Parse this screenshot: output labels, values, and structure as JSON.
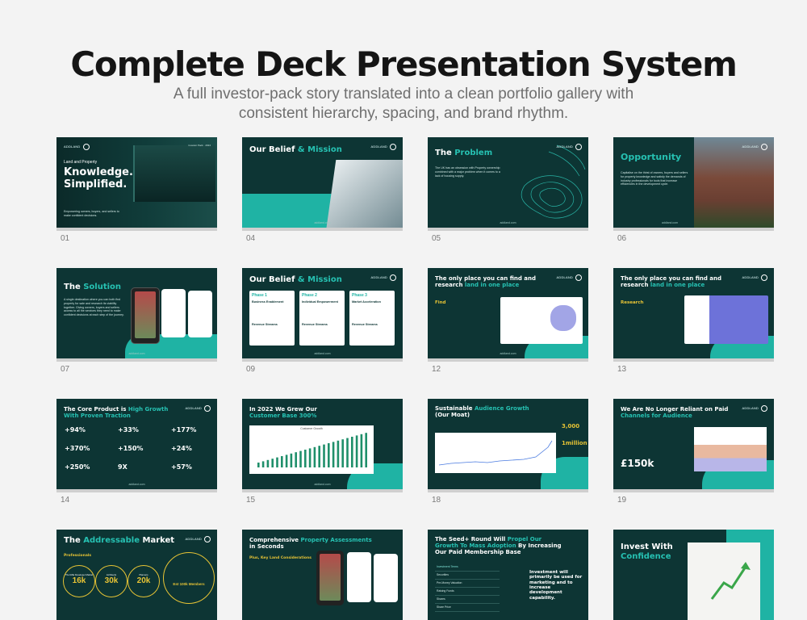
{
  "title": "Complete Deck Presentation System",
  "subtitle": "A full investor-pack story translated into a clean portfolio gallery with consistent hierarchy, spacing, and brand rhythm.",
  "brand": "ADDLAND",
  "website": "addland.com",
  "accent": "#26c1b2",
  "slides": [
    {
      "num": "01",
      "pre": "Land and Property",
      "title": "Knowledge. Simplified.",
      "body": "Empowering owners, buyers, and sellers to make confident decisions.",
      "date": "Investor Pack · 2024"
    },
    {
      "num": "04",
      "title": "Our Belief",
      "accent_text": "& Mission"
    },
    {
      "num": "05",
      "title": "The",
      "accent_text": "Problem",
      "body": "The UK has an obsession with Property ownership combined with a major problem when it comes to a lack of housing supply."
    },
    {
      "num": "06",
      "accent_text": "Opportunity",
      "body": "Capitalise on the thirst of owners, buyers and sellers for property knowledge and satisfy the demands of industry professionals for tools that increase efficiencies in the development cycle."
    },
    {
      "num": "07",
      "title": "The",
      "accent_text": "Solution",
      "body": "A single destination where you can both find property for sale and research its viability together. Giving owners, buyers and sellers access to all the services they need to make confident decisions at each step of the journey."
    },
    {
      "num": "09",
      "title": "Our Belief",
      "accent_text": "& Mission",
      "phases": [
        {
          "label": "Phase 1",
          "head": "Business Enablement"
        },
        {
          "label": "Phase 2",
          "head": "Individual Empowerment"
        },
        {
          "label": "Phase 3",
          "head": "Market Acceleration"
        }
      ],
      "subhead": "Revenue Streams"
    },
    {
      "num": "12",
      "title": "The only place you can find and research",
      "accent_text": "land in one place",
      "tag": "Find"
    },
    {
      "num": "13",
      "title": "The only place you can find and research",
      "accent_text": "land in one place",
      "tag": "Research"
    },
    {
      "num": "14",
      "title": "The Core Product is",
      "accent_text": "High Growth",
      "title2": "With Proven Traction",
      "stats": [
        "+94%",
        "+33%",
        "+177%",
        "+370%",
        "+150%",
        "+24%",
        "+250%",
        "9X",
        "+57%"
      ]
    },
    {
      "num": "15",
      "title": "In 2022 We Grew Our",
      "accent_text": "Customer Base 300%",
      "chart_title": "Customer Growth"
    },
    {
      "num": "18",
      "title": "Sustainable",
      "accent_text": "Audience Growth",
      "title2": "(Our Moat)",
      "kpis": [
        "3,000",
        "1million"
      ]
    },
    {
      "num": "19",
      "title": "We Are No Longer Reliant on Paid",
      "accent_text": "Channels for Audience",
      "kpi": "£150k"
    },
    {
      "num": "",
      "title": "The",
      "accent_text": "Addressable",
      "title2": "Market",
      "tag": "Professionals",
      "circles": [
        "16k",
        "30k",
        "20k"
      ],
      "circle_labels": [
        "The RAE Developer Market",
        "Architects",
        "Planners"
      ],
      "outer": "Est 100k Members"
    },
    {
      "num": "",
      "title": "Comprehensive",
      "accent_text": "Property Assessments",
      "title2": "in Seconds",
      "tag": "Plus, Key Land Considerations"
    },
    {
      "num": "",
      "title": "The Seed+ Round Will",
      "accent_text": "Propel Our Growth To Mass Adoption",
      "title2": "By Increasing Our Paid Membership Base",
      "body": "Investment will primarily be used for marketing and to increase development capability.",
      "rows": [
        "Investment Terms",
        "Securities",
        "Pre-Money Valuation",
        "Raising Funds",
        "Shares",
        "Share Price"
      ]
    },
    {
      "num": "",
      "title": "Invest With",
      "accent_text": "Confidence"
    }
  ]
}
